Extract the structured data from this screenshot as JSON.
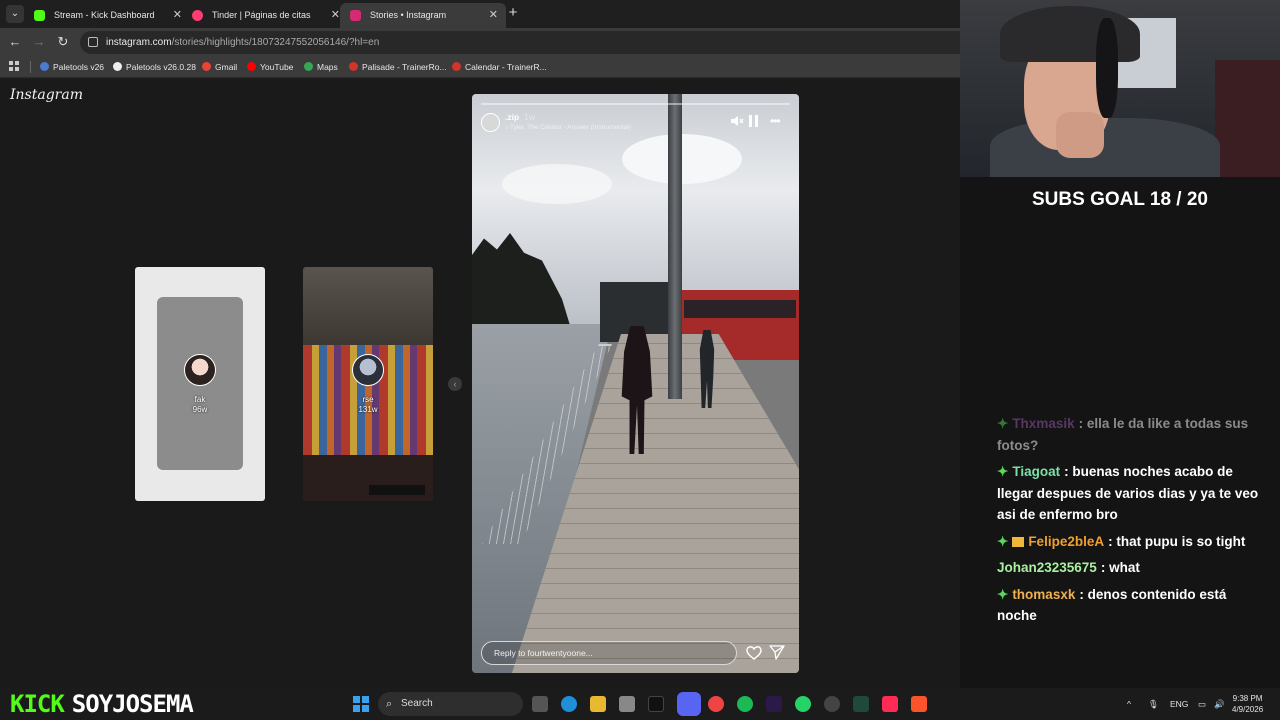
{
  "browser": {
    "tabs": [
      {
        "title": "Stream - Kick Dashboard",
        "favicon_color": "#53fc18",
        "active": false
      },
      {
        "title": "Tinder | Páginas de citas",
        "favicon_color": "#fe3c72",
        "active": false
      },
      {
        "title": "Stories • Instagram",
        "favicon_color": "#d62976",
        "active": true
      }
    ],
    "url_domain": "instagram.com",
    "url_path": "/stories/highlights/18073247552056146/?hl=en",
    "bookmarks": [
      {
        "label": "Paletools v26",
        "color": "#4a7bd0"
      },
      {
        "label": "Paletools v26.0.28",
        "color": "#eeeeee"
      },
      {
        "label": "Gmail",
        "color": "#ea4335"
      },
      {
        "label": "YouTube",
        "color": "#ff0000"
      },
      {
        "label": "Maps",
        "color": "#34a853"
      },
      {
        "label": "Palisade - TrainerRo...",
        "color": "#d0352a"
      },
      {
        "label": "Calendar - TrainerR...",
        "color": "#d0352a"
      }
    ]
  },
  "instagram": {
    "logo": "Instagram",
    "previews": [
      {
        "user": "fak",
        "time": "96w"
      },
      {
        "user": "rse",
        "time": "131w"
      }
    ],
    "story": {
      "user": ".zip",
      "time": "1w",
      "music": "Tyler, The Creator - Answer (Instrumental)",
      "reply_placeholder": "Reply to fourtwentyoone...",
      "progress": 0.0
    }
  },
  "stream": {
    "subs_goal": "SUBS GOAL 18 / 20",
    "chat": [
      {
        "user": "Thxmasik",
        "user_color": "#9b59b6",
        "text": ": ella le da like a todas sus fotos?",
        "faded": true,
        "badge": "gem"
      },
      {
        "user": "Tiagoat",
        "user_color": "#7ee0a8",
        "text": ": buenas noches acabo de llegar despues de varios dias y ya te veo asi de enfermo bro",
        "faded": false,
        "badge": "gem"
      },
      {
        "user": "Felipe2bleA",
        "user_color": "#f0a030",
        "text": ": that pupu is so tight",
        "faded": false,
        "badge": "gem-crown"
      },
      {
        "user": "Johan23235675",
        "user_color": "#a8f0a0",
        "text": ": what",
        "faded": false,
        "badge": "none"
      },
      {
        "user": "thomasxk",
        "user_color": "#f0b050",
        "text": ": denos contenido está noche",
        "faded": false,
        "badge": "gem"
      }
    ],
    "brand_kick": "KICK",
    "brand_name": "SOYJOSEMA"
  },
  "taskbar": {
    "search_label": "Search",
    "language": "ENG",
    "time": "9:38 PM",
    "date": "4/9/2026"
  },
  "colors": {
    "kick_green": "#53fc18",
    "windows_blue": "#3aa0f0"
  }
}
